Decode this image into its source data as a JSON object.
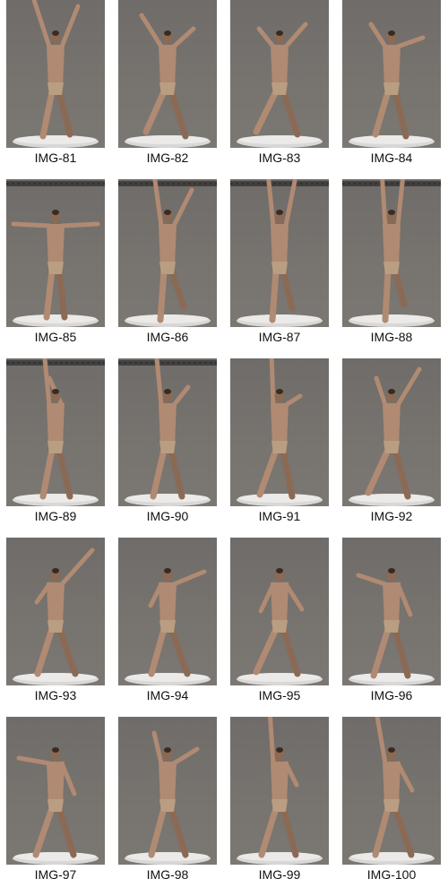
{
  "gallery": {
    "items": [
      {
        "label": "IMG-81"
      },
      {
        "label": "IMG-82"
      },
      {
        "label": "IMG-83"
      },
      {
        "label": "IMG-84"
      },
      {
        "label": "IMG-85"
      },
      {
        "label": "IMG-86"
      },
      {
        "label": "IMG-87"
      },
      {
        "label": "IMG-88"
      },
      {
        "label": "IMG-89"
      },
      {
        "label": "IMG-90"
      },
      {
        "label": "IMG-91"
      },
      {
        "label": "IMG-92"
      },
      {
        "label": "IMG-93"
      },
      {
        "label": "IMG-94"
      },
      {
        "label": "IMG-95"
      },
      {
        "label": "IMG-96"
      },
      {
        "label": "IMG-97"
      },
      {
        "label": "IMG-98"
      },
      {
        "label": "IMG-99"
      },
      {
        "label": "IMG-100"
      }
    ]
  }
}
